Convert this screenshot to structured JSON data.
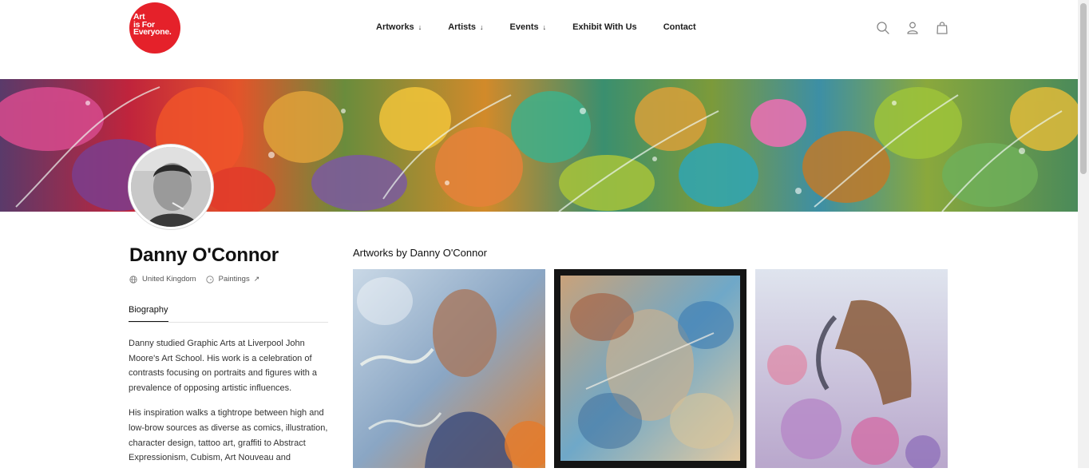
{
  "logo": {
    "line1": "Art",
    "line2": "is For",
    "line3": "Everyone.",
    "color": "#e5212a"
  },
  "nav": {
    "items": [
      {
        "label": "Artworks",
        "arrow": "↓"
      },
      {
        "label": "Artists",
        "arrow": "↓"
      },
      {
        "label": "Events",
        "arrow": "↓"
      },
      {
        "label": "Exhibit With Us"
      },
      {
        "label": "Contact"
      }
    ]
  },
  "header_icons": [
    "search-icon",
    "user-icon",
    "cart-icon"
  ],
  "artist": {
    "name": "Danny O'Connor",
    "country": "United Kingdom",
    "medium": "Paintings",
    "external_arrow": "↗"
  },
  "tabs": {
    "biography": "Biography"
  },
  "bio": {
    "p1": "Danny studied Graphic Arts at Liverpool John Moore's Art School. His work is a celebration of contrasts focusing on portraits and figures with a prevalence of opposing artistic influences.",
    "p2": "His inspiration walks a tightrope between high and low-brow sources as diverse as comics, illustration, character design, tattoo art, graffiti to Abstract Expressionism, Cubism, Art Nouveau and"
  },
  "artworks": {
    "title": "Artworks by Danny O'Connor"
  }
}
